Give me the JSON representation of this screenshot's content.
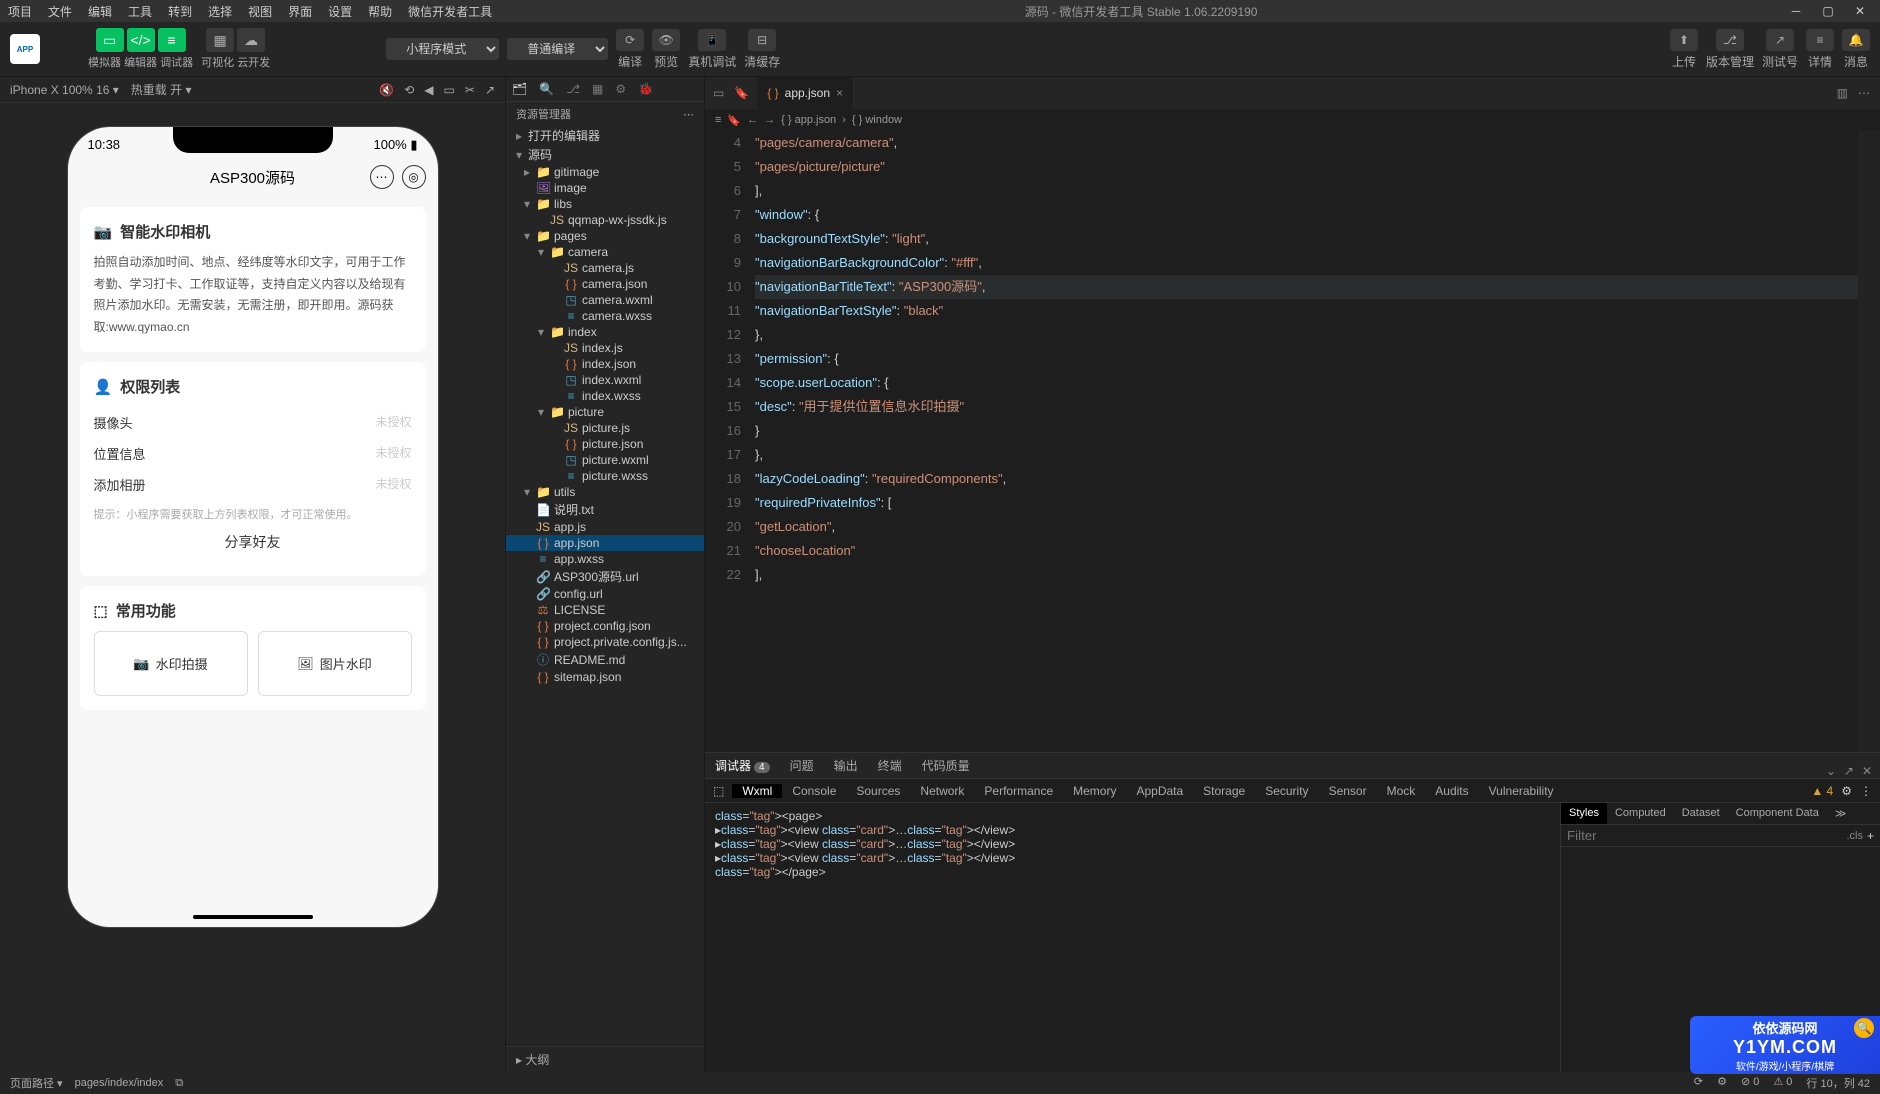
{
  "window": {
    "title": "源码 - 微信开发者工具 Stable 1.06.2209190",
    "menu": [
      "项目",
      "文件",
      "编辑",
      "工具",
      "转到",
      "选择",
      "视图",
      "界面",
      "设置",
      "帮助",
      "微信开发者工具"
    ]
  },
  "toolbar": {
    "groups": {
      "sim": "模拟器",
      "editor": "编辑器",
      "debugger": "调试器",
      "visual": "可视化",
      "cloud": "云开发"
    },
    "modeSel": "小程序模式",
    "compileSel": "普通编译",
    "compile": "编译",
    "preview": "预览",
    "remote": "真机调试",
    "clear": "清缓存",
    "upload": "上传",
    "version": "版本管理",
    "testid": "测试号",
    "detail": "详情",
    "msg": "消息"
  },
  "sim": {
    "device": "iPhone X 100% 16 ▾",
    "hot": "热重载 开 ▾",
    "time": "10:38",
    "battery": "100%",
    "navTitle": "ASP300源码",
    "card1_title": "智能水印相机",
    "card1_body": "拍照自动添加时间、地点、经纬度等水印文字，可用于工作考勤、学习打卡、工作取证等，支持自定义内容以及给现有照片添加水印。无需安装，无需注册，即开即用。源码获取:www.qymao.cn",
    "card2_title": "权限列表",
    "perm1": "摄像头",
    "perm2": "位置信息",
    "perm3": "添加相册",
    "unauth": "未授权",
    "hint": "提示：小程序需要获取上方列表权限，才可正常使用。",
    "share": "分享好友",
    "card3_title": "常用功能",
    "func1": "水印拍摄",
    "func2": "图片水印"
  },
  "explorer": {
    "header": "资源管理器",
    "sec1": "打开的编辑器",
    "sec2": "源码",
    "outline": "大纲",
    "tree": [
      {
        "d": 1,
        "t": "folder",
        "exp": false,
        "label": "gitimage"
      },
      {
        "d": 1,
        "t": "img",
        "label": "image"
      },
      {
        "d": 1,
        "t": "folder",
        "exp": true,
        "label": "libs"
      },
      {
        "d": 2,
        "t": "js",
        "label": "qqmap-wx-jssdk.js"
      },
      {
        "d": 1,
        "t": "folder",
        "exp": true,
        "label": "pages"
      },
      {
        "d": 2,
        "t": "folder",
        "exp": true,
        "label": "camera"
      },
      {
        "d": 3,
        "t": "js",
        "label": "camera.js"
      },
      {
        "d": 3,
        "t": "json",
        "label": "camera.json"
      },
      {
        "d": 3,
        "t": "wxml",
        "label": "camera.wxml"
      },
      {
        "d": 3,
        "t": "wxss",
        "label": "camera.wxss"
      },
      {
        "d": 2,
        "t": "folder",
        "exp": true,
        "label": "index"
      },
      {
        "d": 3,
        "t": "js",
        "label": "index.js"
      },
      {
        "d": 3,
        "t": "json",
        "label": "index.json"
      },
      {
        "d": 3,
        "t": "wxml",
        "label": "index.wxml"
      },
      {
        "d": 3,
        "t": "wxss",
        "label": "index.wxss"
      },
      {
        "d": 2,
        "t": "folder",
        "exp": true,
        "label": "picture"
      },
      {
        "d": 3,
        "t": "js",
        "label": "picture.js"
      },
      {
        "d": 3,
        "t": "json",
        "label": "picture.json"
      },
      {
        "d": 3,
        "t": "wxml",
        "label": "picture.wxml"
      },
      {
        "d": 3,
        "t": "wxss",
        "label": "picture.wxss"
      },
      {
        "d": 1,
        "t": "folder",
        "exp": true,
        "label": "utils"
      },
      {
        "d": 1,
        "t": "txt",
        "label": "说明.txt"
      },
      {
        "d": 1,
        "t": "js",
        "label": "app.js"
      },
      {
        "d": 1,
        "t": "json",
        "label": "app.json",
        "sel": true
      },
      {
        "d": 1,
        "t": "wxss",
        "label": "app.wxss"
      },
      {
        "d": 1,
        "t": "url",
        "label": "ASP300源码.url"
      },
      {
        "d": 1,
        "t": "url",
        "label": "config.url"
      },
      {
        "d": 1,
        "t": "lic",
        "label": "LICENSE"
      },
      {
        "d": 1,
        "t": "json",
        "label": "project.config.json"
      },
      {
        "d": 1,
        "t": "json",
        "label": "project.private.config.js..."
      },
      {
        "d": 1,
        "t": "md",
        "label": "README.md"
      },
      {
        "d": 1,
        "t": "json",
        "label": "sitemap.json"
      }
    ]
  },
  "editor": {
    "tab": "app.json",
    "breadcrumb": [
      "{ } app.json",
      "{ } window"
    ],
    "lines": [
      {
        "n": 4,
        "html": "    <span class='s-str'>\"pages/camera/camera\"</span><span class='s-pun'>,</span>"
      },
      {
        "n": 5,
        "html": "    <span class='s-str'>\"pages/picture/picture\"</span>"
      },
      {
        "n": 6,
        "html": "  <span class='s-pun'>],</span>"
      },
      {
        "n": 7,
        "html": "  <span class='s-key'>\"window\"</span><span class='s-pun'>: {</span>"
      },
      {
        "n": 8,
        "html": "    <span class='s-key'>\"backgroundTextStyle\"</span><span class='s-pun'>: </span><span class='s-str'>\"light\"</span><span class='s-pun'>,</span>"
      },
      {
        "n": 9,
        "html": "    <span class='s-key'>\"navigationBarBackgroundColor\"</span><span class='s-pun'>: </span><span class='s-str'>\"#fff\"</span><span class='s-pun'>,</span>"
      },
      {
        "n": 10,
        "hl": true,
        "html": "    <span class='s-key'>\"navigationBarTitleText\"</span><span class='s-pun'>: </span><span class='s-str'>\"ASP300源码\"</span><span class='s-pun'>,</span>"
      },
      {
        "n": 11,
        "html": "    <span class='s-key'>\"navigationBarTextStyle\"</span><span class='s-pun'>: </span><span class='s-str'>\"black\"</span>"
      },
      {
        "n": 12,
        "html": "  <span class='s-pun'>},</span>"
      },
      {
        "n": 13,
        "html": "  <span class='s-key'>\"permission\"</span><span class='s-pun'>: {</span>"
      },
      {
        "n": 14,
        "html": "    <span class='s-key'>\"scope.userLocation\"</span><span class='s-pun'>: {</span>"
      },
      {
        "n": 15,
        "html": "      <span class='s-key'>\"desc\"</span><span class='s-pun'>: </span><span class='s-str'>\"用于提供位置信息水印拍摄\"</span>"
      },
      {
        "n": 16,
        "html": "    <span class='s-pun'>}</span>"
      },
      {
        "n": 17,
        "html": "  <span class='s-pun'>},</span>"
      },
      {
        "n": 18,
        "html": "  <span class='s-key'>\"lazyCodeLoading\"</span><span class='s-pun'>: </span><span class='s-str'>\"requiredComponents\"</span><span class='s-pun'>,</span>"
      },
      {
        "n": 19,
        "html": "  <span class='s-key'>\"requiredPrivateInfos\"</span><span class='s-pun'>: [</span>"
      },
      {
        "n": 20,
        "html": "    <span class='s-str'>\"getLocation\"</span><span class='s-pun'>,</span>"
      },
      {
        "n": 21,
        "html": "    <span class='s-str'>\"chooseLocation\"</span>"
      },
      {
        "n": 22,
        "html": "  <span class='s-pun'>],</span>"
      }
    ]
  },
  "debugger": {
    "tabs": [
      "调试器",
      "问题",
      "输出",
      "终端",
      "代码质量"
    ],
    "badge": "4",
    "sub": [
      "Wxml",
      "Console",
      "Sources",
      "Network",
      "Performance",
      "Memory",
      "AppData",
      "Storage",
      "Security",
      "Sensor",
      "Mock",
      "Audits",
      "Vulnerability"
    ],
    "warnCount": "4",
    "dom": [
      "<page>",
      "▸<view class=\"card\">…</view>",
      "▸<view class=\"card\">…</view>",
      "▸<view class=\"card\">…</view>",
      "</page>"
    ],
    "styleTabs": [
      "Styles",
      "Computed",
      "Dataset",
      "Component Data"
    ],
    "filterPh": "Filter",
    "cls": ".cls"
  },
  "status": {
    "pathLabel": "页面路径 ▾",
    "path": "pages/index/index",
    "err": "⊘ 0",
    "warn": "⚠ 0",
    "pos": "行 10，列 42"
  },
  "watermark": {
    "a": "依依源码网",
    "b": "Y1YM.COM",
    "c": "软件/游戏/小程序/棋牌"
  }
}
